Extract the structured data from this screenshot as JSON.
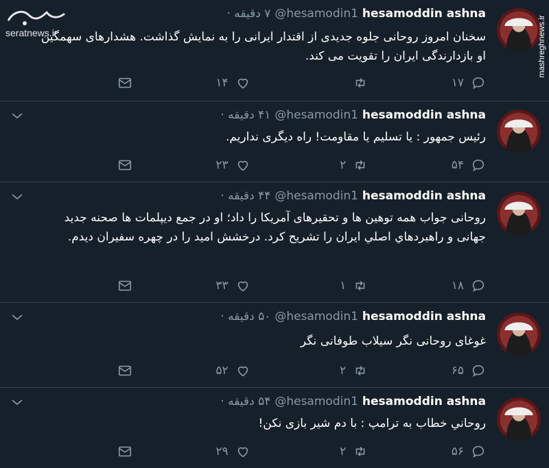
{
  "watermarks": {
    "serat_url": "seratnews.ir",
    "mashregh_url": "mashreghnews.ir"
  },
  "tweets": [
    {
      "name": "hesamoddin ashna",
      "handle": "@hesamodin1",
      "time": "۷ دقیقه ·",
      "text": "سخنان امروز روحانی جلوه جدیدی از اقتدار ایرانی را به نمایش گذاشت. هشدارهای سهمگین او  بازدارندگی ایران را تقویت می کند.",
      "replies": "۱۷",
      "retweets": "",
      "likes": "۱۴"
    },
    {
      "name": "hesamoddin ashna",
      "handle": "@hesamodin1",
      "time": "۴۱ دقیقه ·",
      "text": "رئیس جمهور : یا تسلیم یا مقاومت! راه دیگری نداریم.",
      "replies": "۵۴",
      "retweets": "۲",
      "likes": "۲۳"
    },
    {
      "name": "hesamoddin ashna",
      "handle": "@hesamodin1",
      "time": "۴۴ دقیقه ·",
      "text": "روحانی جواب همه توهین ها و تحقیرهای آمریکا را داد؛ او در جمع دیپلمات ها صحنه جدید جهانی و راهبردهاي اصلي ايران را تشریح کرد. درخشش امید را در چهره سفیران دیدم.",
      "replies": "۱۸",
      "retweets": "۱",
      "likes": "۳۳"
    },
    {
      "name": "hesamoddin ashna",
      "handle": "@hesamodin1",
      "time": "۵۰ دقیقه ·",
      "text": "غوغای روحانی نگر  سیلاب طوفانی نگر",
      "replies": "۶۵",
      "retweets": "۲",
      "likes": "۵۲"
    },
    {
      "name": "hesamoddin ashna",
      "handle": "@hesamodin1",
      "time": "۵۴ دقیقه ·",
      "text": "روحاني خطاب به ترامپ : با دم شیر بازی نکن!",
      "replies": "۵۶",
      "retweets": "۲",
      "likes": "۲۹"
    }
  ]
}
